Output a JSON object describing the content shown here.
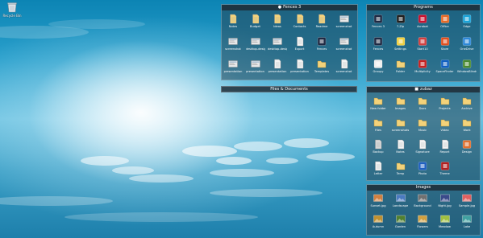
{
  "desktop": {
    "recycle_bin_label": "Recycle Bin"
  },
  "fences": {
    "fences3": {
      "title": "Fences 3",
      "title_icon": "pin-icon",
      "items": [
        {
          "name": "Notes",
          "icon": "file-icon",
          "color": "#f3d27a"
        },
        {
          "name": "Budget",
          "icon": "file-icon",
          "color": "#f3d27a"
        },
        {
          "name": "Ideas",
          "icon": "file-icon",
          "color": "#f3d27a"
        },
        {
          "name": "Contacts",
          "icon": "file-icon",
          "color": "#f3d27a"
        },
        {
          "name": "Readme",
          "icon": "file-icon",
          "color": "#f3d27a"
        },
        {
          "name": "screenshot",
          "icon": "image-icon",
          "color": "#e8e8e8"
        },
        {
          "name": "screenshot",
          "icon": "image-icon",
          "color": "#e8e8e8"
        },
        {
          "name": "desktop-design",
          "icon": "image-icon",
          "color": "#e8e8e8"
        },
        {
          "name": "desktop-design",
          "icon": "image-icon",
          "color": "#e8e8e8"
        },
        {
          "name": "Export",
          "icon": "doc-icon",
          "color": "#f4f4f4"
        },
        {
          "name": "Fences",
          "icon": "app-icon",
          "color": "#1f2a44"
        },
        {
          "name": "screenshot",
          "icon": "image-icon",
          "color": "#e8e8e8"
        },
        {
          "name": "presentation",
          "icon": "image-icon",
          "color": "#e8e8e8"
        },
        {
          "name": "presentation",
          "icon": "image-icon",
          "color": "#e8e8e8"
        },
        {
          "name": "presentation",
          "icon": "doc-icon",
          "color": "#f4f4f4"
        },
        {
          "name": "presentation",
          "icon": "doc-icon",
          "color": "#f4f4f4"
        },
        {
          "name": "Templates",
          "icon": "folder-icon",
          "color": "#f3d27a"
        },
        {
          "name": "screenshot",
          "icon": "doc-icon",
          "color": "#f4f4f4"
        }
      ]
    },
    "programs": {
      "title": "Programs",
      "items": [
        {
          "name": "Fences 3",
          "icon": "app-icon",
          "color": "#1f2a44"
        },
        {
          "name": "7-Zip",
          "icon": "app-icon",
          "color": "#202020"
        },
        {
          "name": "Acrobat",
          "icon": "app-icon",
          "color": "#c8102e"
        },
        {
          "name": "Office",
          "icon": "app-icon",
          "color": "#e76a26"
        },
        {
          "name": "Edge",
          "icon": "app-icon",
          "color": "#1aa3d8"
        },
        {
          "name": "Fences",
          "icon": "app-icon",
          "color": "#1f2a44"
        },
        {
          "name": "Settings",
          "icon": "app-icon",
          "color": "#f0d040"
        },
        {
          "name": "Start10",
          "icon": "app-icon",
          "color": "#d24040"
        },
        {
          "name": "Store",
          "icon": "app-icon",
          "color": "#e05020"
        },
        {
          "name": "OneDrive",
          "icon": "app-icon",
          "color": "#2d88d8"
        },
        {
          "name": "Groupy",
          "icon": "app-icon",
          "color": "#eeeeee"
        },
        {
          "name": "Folder",
          "icon": "folder-icon",
          "color": "#f3d27a"
        },
        {
          "name": "Multiplicity",
          "icon": "app-icon",
          "color": "#c82020"
        },
        {
          "name": "SpaceFinder",
          "icon": "app-icon",
          "color": "#1060c0"
        },
        {
          "name": "WindowBlinds",
          "icon": "app-icon",
          "color": "#4a8a30"
        }
      ]
    },
    "zubaz": {
      "title": "zubaz",
      "title_icon": "folder-icon",
      "items": [
        {
          "name": "New folder",
          "icon": "folder-icon",
          "color": "#f3d27a"
        },
        {
          "name": "Images",
          "icon": "folder-icon",
          "color": "#f3d27a"
        },
        {
          "name": "Docs",
          "icon": "folder-icon",
          "color": "#f3d27a"
        },
        {
          "name": "Projects",
          "icon": "folder-icon",
          "color": "#f3d27a"
        },
        {
          "name": "Archive",
          "icon": "folder-icon",
          "color": "#f3d27a"
        },
        {
          "name": "Files",
          "icon": "folder-icon",
          "color": "#f3d27a"
        },
        {
          "name": "screenshots",
          "icon": "folder-icon",
          "color": "#f3d27a"
        },
        {
          "name": "Music",
          "icon": "folder-icon",
          "color": "#f3d27a"
        },
        {
          "name": "Video",
          "icon": "folder-icon",
          "color": "#f3d27a"
        },
        {
          "name": "Work",
          "icon": "folder-icon",
          "color": "#f3d27a"
        },
        {
          "name": "Backup",
          "icon": "doc-icon",
          "color": "#d8d8d8"
        },
        {
          "name": "Notes",
          "icon": "doc-icon",
          "color": "#f4f4f4"
        },
        {
          "name": "Signature",
          "icon": "doc-icon",
          "color": "#f4f4f4"
        },
        {
          "name": "Report",
          "icon": "doc-icon",
          "color": "#f4f4f4"
        },
        {
          "name": "Design",
          "icon": "app-icon",
          "color": "#e07030"
        },
        {
          "name": "Letter",
          "icon": "doc-icon",
          "color": "#f4f4f4"
        },
        {
          "name": "Temp",
          "icon": "folder-icon",
          "color": "#f3d27a"
        },
        {
          "name": "Photo",
          "icon": "app-icon",
          "color": "#2060c0"
        },
        {
          "name": "Theme",
          "icon": "app-icon",
          "color": "#b02020"
        }
      ]
    },
    "images": {
      "title": "Images",
      "items": [
        {
          "name": "Sunset.jpg",
          "icon": "photo-icon",
          "color": "#d08040"
        },
        {
          "name": "Landscape",
          "icon": "photo-icon",
          "color": "#4a7ac0"
        },
        {
          "name": "Background",
          "icon": "photo-icon",
          "color": "#707070"
        },
        {
          "name": "Night.jpg",
          "icon": "photo-icon",
          "color": "#3a4a8a"
        },
        {
          "name": "Sample.jpg",
          "icon": "photo-icon",
          "color": "#e06060"
        },
        {
          "name": "Autumn",
          "icon": "photo-icon",
          "color": "#c09030"
        },
        {
          "name": "Garden",
          "icon": "photo-icon",
          "color": "#508030"
        },
        {
          "name": "Flowers",
          "icon": "photo-icon",
          "color": "#d0a040"
        },
        {
          "name": "Meadow",
          "icon": "photo-icon",
          "color": "#a0c040"
        },
        {
          "name": "Lake",
          "icon": "photo-icon",
          "color": "#40a0a0"
        }
      ]
    },
    "files_documents": {
      "title": "Files & Documents"
    }
  }
}
